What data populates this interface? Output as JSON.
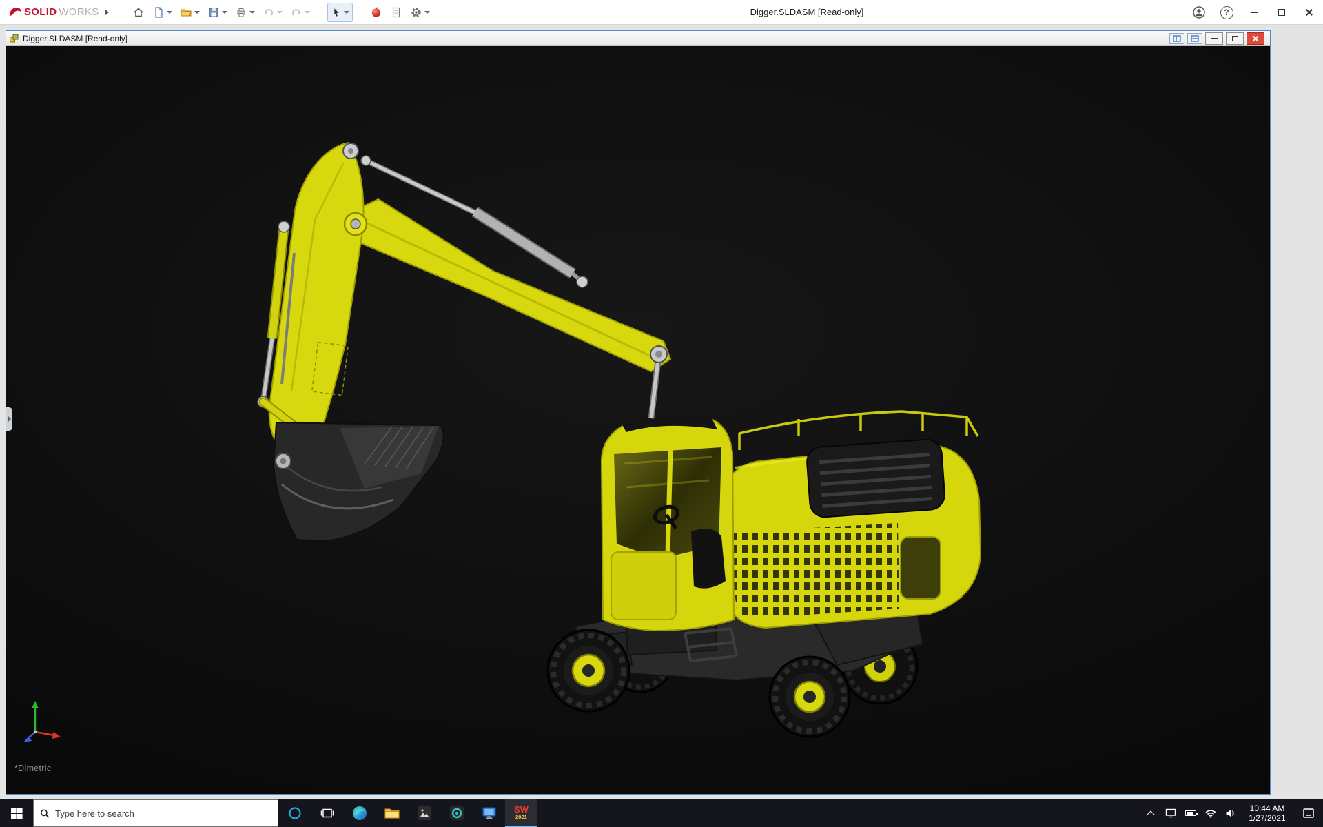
{
  "app": {
    "brand": {
      "solid": "SOLID",
      "works": "WORKS"
    },
    "title": "Digger.SLDASM [Read-only]",
    "help_glyph": "?"
  },
  "doc_window": {
    "title": "Digger.SLDASM [Read-only]"
  },
  "viewport": {
    "view_label": "*Dimetric"
  },
  "taskbar": {
    "search_placeholder": "Type here to search",
    "clock": {
      "time": "10:44 AM",
      "date": "1/27/2021"
    },
    "solidworks_glyph": "SW",
    "solidworks_badge": "2021"
  },
  "colors": {
    "excavator_yellow": "#d8d80e",
    "accent_blue": "#76b9ed",
    "brand_red": "#c8102e",
    "taskbar_bg": "#15151e"
  }
}
